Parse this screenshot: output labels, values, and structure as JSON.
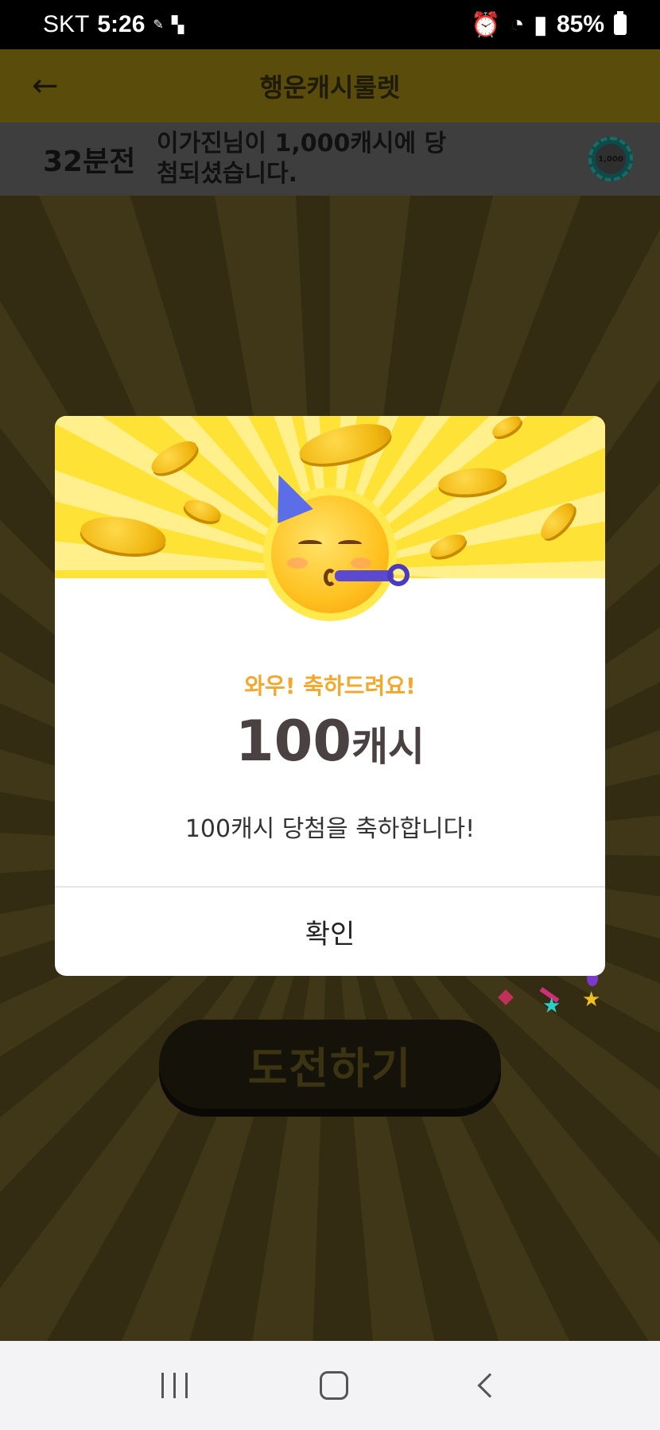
{
  "status_bar": {
    "carrier": "SKT",
    "time": "5:26",
    "app_notif": "cash feed",
    "battery": "85%"
  },
  "header": {
    "title": "행운캐시룰렛"
  },
  "ticker": {
    "time_ago": "32분전",
    "message": "이가진님이 1,000캐시에 당첨되셨습니다.",
    "chip_label": "1,000"
  },
  "main": {
    "challenge_label": "도전하기"
  },
  "modal": {
    "subtitle": "와우! 축하드려요!",
    "amount_number": "100",
    "amount_unit": "캐시",
    "description": "100캐시 당첨을 축하합니다!",
    "confirm_label": "확인"
  },
  "colors": {
    "accent": "#ffdf1d",
    "subtitle": "#f3a82b",
    "amount": "#4a4242"
  }
}
